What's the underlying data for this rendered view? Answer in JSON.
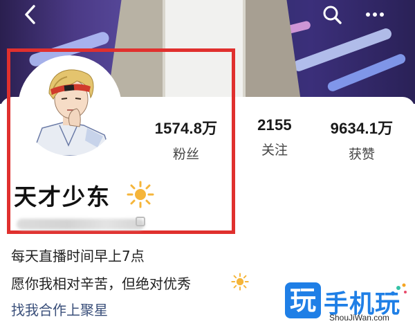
{
  "profile": {
    "username": "天才少东",
    "stats": [
      {
        "value": "1574.8万",
        "label": "粉丝"
      },
      {
        "value": "2155",
        "label": "关注"
      },
      {
        "value": "9634.1万",
        "label": "获赞"
      }
    ],
    "bio_lines": [
      "每天直播时间早上7点",
      "愿你我相对辛苦，但绝对优秀",
      "找我合作上聚星"
    ]
  },
  "watermark": {
    "logo_char": "玩",
    "title": "手机玩",
    "url": "ShouJiWan.com"
  },
  "colors": {
    "highlight_box": "#e0302e",
    "link": "#3a4f7a",
    "watermark": "#1f7fe6"
  },
  "icons": [
    "back-icon",
    "search-icon",
    "more-icon",
    "sun-icon",
    "copy-icon"
  ]
}
